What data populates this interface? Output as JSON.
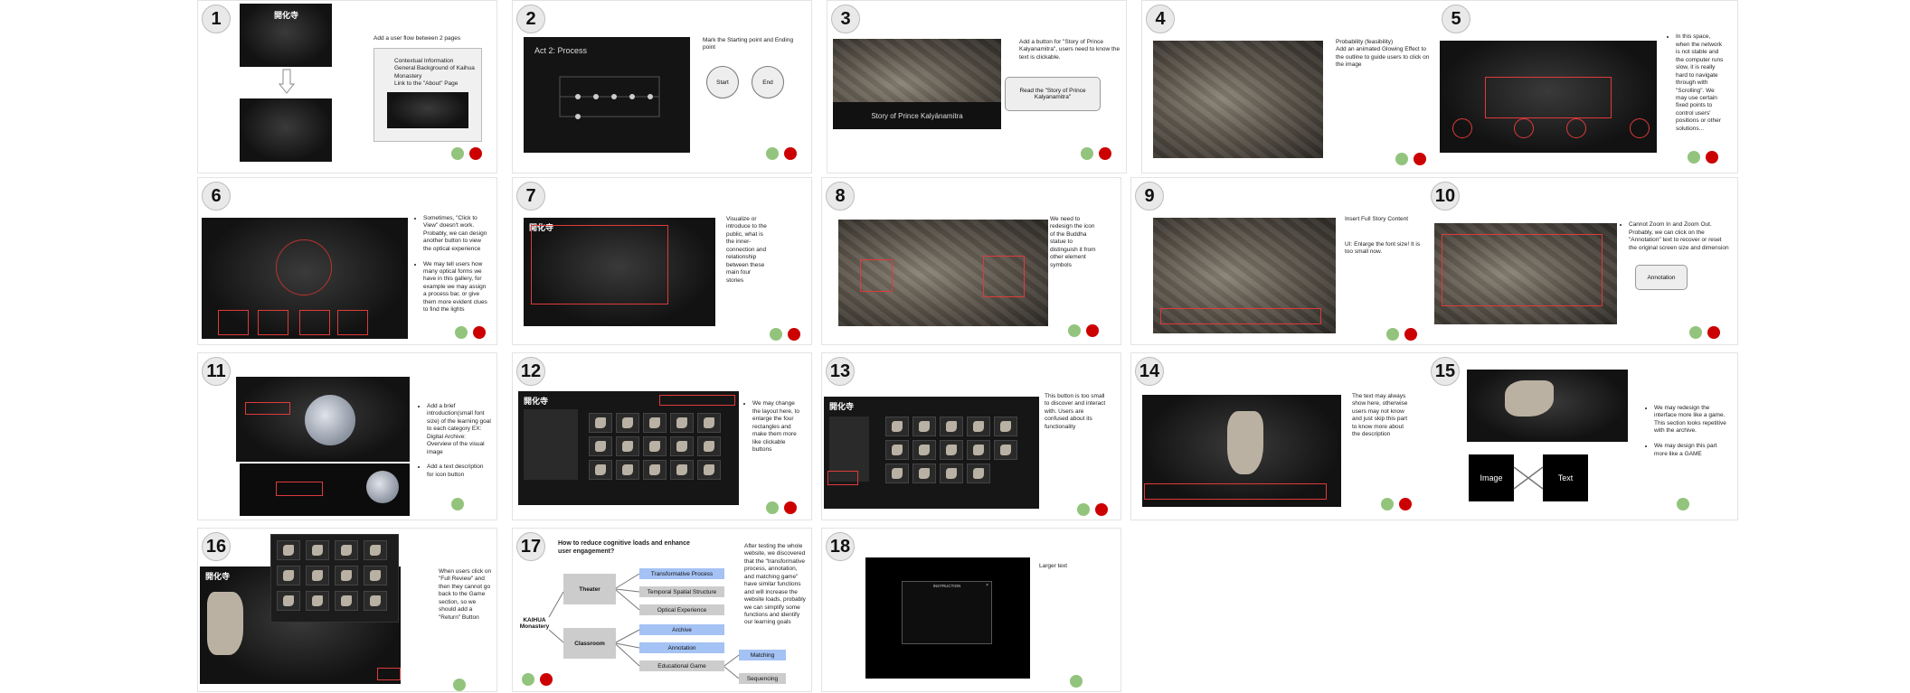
{
  "colors": {
    "good": "#93c47d",
    "bad": "#cc0000",
    "highlight": "#e03a3a",
    "blue_box": "#a4c2f4",
    "grey_box": "#cccccc"
  },
  "panels": [
    {
      "number": "1",
      "notes": [
        "Add a user flow between 2 pages"
      ],
      "callout": "Contextual Information\nGeneral Background of Kaihua Monastery\nLink to the \"About\" Page"
    },
    {
      "number": "2",
      "notes": [
        "Mark the Starting point and Ending point"
      ],
      "screen_title": "Act 2: Process",
      "start": "Start",
      "end": "End"
    },
    {
      "number": "3",
      "notes": [
        "Add a button for \"Story of Prince Kalyanamitra\", users need to know the text is clickable."
      ],
      "screen_caption": "Story of Prince Kalyānamitra",
      "button": "Read the \"Story of Prince Kalyanamitra\""
    },
    {
      "number": "4",
      "notes": [
        "Probability (feasibility)\nAdd an animated Glowing Effect to the outline to guide users to click on the image"
      ]
    },
    {
      "number": "5",
      "notes": [
        "In this space, when the network is not stable and the computer runs slow, it is really hard to navigate through with \"Scrolling\". We may use certain fixed points to control users' positions or other solutions..."
      ]
    },
    {
      "number": "6",
      "notes": [
        "Sometimes, \"Click to View\" doesn't work. Probably, we can design another button to view the optical experience",
        "We may tell users how many optical forms we have in this gallery, for example we may assign a process bar, or give them more evident clues to find the lights"
      ]
    },
    {
      "number": "7",
      "notes": [
        "Visualize or introduce to the public, what is the inner-connection and relationship between these main four stories"
      ]
    },
    {
      "number": "8",
      "notes": [
        "We need to redesign the icon of the Buddha statue to distinguish it from other element symbols"
      ]
    },
    {
      "number": "9",
      "notes": [
        "Insert Full Story Content",
        "UI:  Enlarge the font size! It is too small now."
      ]
    },
    {
      "number": "10",
      "notes": [
        "Cannot Zoom In and Zoom Out. Probably, we can click on the \"Annotation\" text to recover or reset the original screen size and dimension"
      ],
      "button": "Annotation"
    },
    {
      "number": "11",
      "notes": [
        "Add a brief introduction(small font size) of the learning goal to each category EX: Digital Archive: Overview of the visual image",
        "Add a text description for icon button"
      ]
    },
    {
      "number": "12",
      "notes": [
        "We may change the layout here, to enlarge the four rectangles and make them more like clickable buttons"
      ]
    },
    {
      "number": "13",
      "notes": [
        "This button is too small to discover and interact with. Users are confused about its functionality"
      ]
    },
    {
      "number": "14",
      "notes": [
        "The text may always show here, otherwise users may not know and just skip this part to know more about the description"
      ]
    },
    {
      "number": "15",
      "notes": [
        "We may redesign the interface more like a game. This section looks repetitive with the archive.",
        "We may design this part more like a GAME"
      ],
      "left_box": "Image",
      "right_box": "Text"
    },
    {
      "number": "16",
      "notes": [
        "When users click on \"Full Review\" and then they cannot go back to the Game section, so we should add a \"Return\" Button"
      ]
    },
    {
      "number": "17",
      "notes": [
        "After testing the whole website, we discovered that the \"transformative process, annotation, and matching game\" have similar functions and will increase the website loads, probably we can simplify some functions and identify our learning goals"
      ],
      "question": "How to reduce cognitive loads and enhance user engagement?",
      "root": "KAIHUA\nMonastery",
      "theater": "Theater",
      "classroom": "Classroom",
      "theater_items": [
        "Transformative Process",
        "Temporal Spatial Structure",
        "Optical Experience"
      ],
      "classroom_items": [
        "Archive",
        "Annotation",
        "Educational Game"
      ],
      "game_items": [
        "Matching",
        "Sequencing"
      ]
    },
    {
      "number": "18",
      "notes": [
        "Larger text"
      ],
      "dialog_title": "INSTRUCTION"
    }
  ],
  "screen_texts": {
    "logo": "開化寺"
  }
}
